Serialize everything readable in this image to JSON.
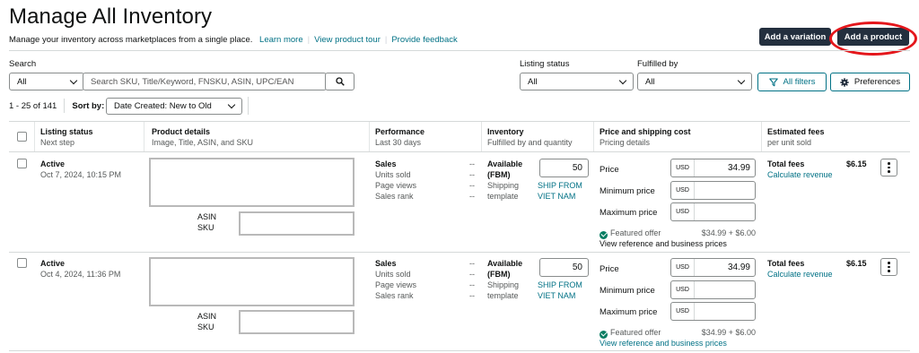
{
  "header": {
    "title": "Manage All Inventory",
    "subtitle": "Manage your inventory across marketplaces from a single place.",
    "links": [
      "Learn more",
      "View product tour",
      "Provide feedback"
    ],
    "add_variation": "Add a variation",
    "add_product": "Add a product"
  },
  "filters": {
    "search_label": "Search",
    "search_scope": "All",
    "search_placeholder": "Search SKU, Title/Keyword, FNSKU, ASIN, UPC/EAN",
    "listing_status_label": "Listing status",
    "listing_status_value": "All",
    "fulfilled_by_label": "Fulfilled by",
    "fulfilled_by_value": "All",
    "all_filters": "All filters",
    "preferences": "Preferences"
  },
  "pagination": {
    "range": "1 - 25 of 141",
    "sort_label": "Sort by:",
    "sort_value": "Date Created: New to Old"
  },
  "columns": [
    {
      "title": "Listing status",
      "sub": "Next step"
    },
    {
      "title": "Product details",
      "sub": "Image, Title, ASIN, and SKU"
    },
    {
      "title": "Performance",
      "sub": "Last 30 days"
    },
    {
      "title": "Inventory",
      "sub": "Fulfilled by and quantity"
    },
    {
      "title": "Price and shipping cost",
      "sub": "Pricing details"
    },
    {
      "title": "Estimated fees",
      "sub": "per unit sold"
    }
  ],
  "labels": {
    "asin": "ASIN",
    "sku": "SKU",
    "sales": "Sales",
    "units_sold": "Units sold",
    "page_views": "Page views",
    "sales_rank": "Sales rank",
    "dash": "--",
    "available": "Available",
    "fbm": "(FBM)",
    "shipping": "Shipping",
    "template": "template",
    "ship_from_1": "SHIP FROM",
    "ship_from_2": "VIET NAM",
    "price": "Price",
    "min_price": "Minimum price",
    "max_price": "Maximum price",
    "usd": "USD",
    "featured_offer": "Featured offer",
    "view_ref": "View reference and business prices",
    "total_fees": "Total fees",
    "calc_revenue": "Calculate revenue"
  },
  "rows": [
    {
      "status": "Active",
      "date": "Oct 7, 2024, 10:15 PM",
      "quantity": "50",
      "price": "34.99",
      "featured": "$34.99 + $6.00",
      "fees": "$6.15"
    },
    {
      "status": "Active",
      "date": "Oct 4, 2024, 11:36 PM",
      "quantity": "50",
      "price": "34.99",
      "featured": "$34.99 + $6.00",
      "fees": "$6.15"
    }
  ]
}
